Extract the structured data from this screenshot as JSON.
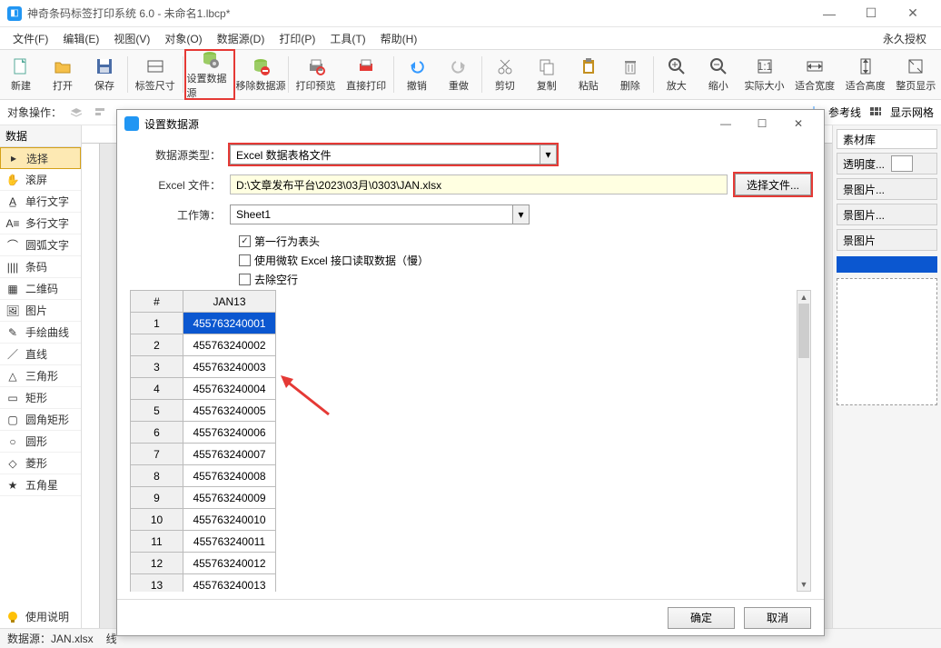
{
  "titlebar": {
    "title": "神奇条码标签打印系统 6.0 - 未命名1.lbcp*"
  },
  "menubar": {
    "items": [
      "文件(F)",
      "编辑(E)",
      "视图(V)",
      "对象(O)",
      "数据源(D)",
      "打印(P)",
      "工具(T)",
      "帮助(H)"
    ],
    "right": "永久授权"
  },
  "toolbar": {
    "items": [
      "新建",
      "打开",
      "保存",
      "标签尺寸",
      "设置数据源",
      "移除数据源",
      "打印预览",
      "直接打印",
      "撤销",
      "重做",
      "剪切",
      "复制",
      "粘贴",
      "删除",
      "放大",
      "缩小",
      "实际大小",
      "适合宽度",
      "适合高度",
      "整页显示"
    ]
  },
  "opsbar": {
    "label": "对象操作：",
    "ref": "参考线",
    "grid": "显示网格"
  },
  "sidebar": {
    "tab": "数据",
    "items": [
      {
        "icon": "cursor",
        "label": "选择",
        "sel": true
      },
      {
        "icon": "hand",
        "label": "滚屏"
      },
      {
        "icon": "A",
        "label": "单行文字"
      },
      {
        "icon": "Am",
        "label": "多行文字"
      },
      {
        "icon": "arc",
        "label": "圆弧文字"
      },
      {
        "icon": "barcode",
        "label": "条码"
      },
      {
        "icon": "qrcode",
        "label": "二维码"
      },
      {
        "icon": "image",
        "label": "图片"
      },
      {
        "icon": "curve",
        "label": "手绘曲线"
      },
      {
        "icon": "line",
        "label": "直线"
      },
      {
        "icon": "tri",
        "label": "三角形"
      },
      {
        "icon": "rect",
        "label": "矩形"
      },
      {
        "icon": "rrect",
        "label": "圆角矩形"
      },
      {
        "icon": "circle",
        "label": "圆形"
      },
      {
        "icon": "diamond",
        "label": "菱形"
      },
      {
        "icon": "star",
        "label": "五角星"
      }
    ]
  },
  "rightpanel": {
    "matlib": "素材库",
    "opacity": "透明度...",
    "bg1": "景图片...",
    "bg2": "景图片...",
    "bg3": "景图片"
  },
  "help": {
    "label": "使用说明"
  },
  "statusbar": {
    "source": "数据源：JAN.xlsx",
    "extra": "线"
  },
  "dialog": {
    "title": "设置数据源",
    "rows": {
      "type_label": "数据源类型：",
      "type_value": "Excel 数据表格文件",
      "file_label": "Excel 文件：",
      "file_value": "D:\\文章发布平台\\2023\\03月\\0303\\JAN.xlsx",
      "choose_btn": "选择文件...",
      "sheet_label": "工作簿：",
      "sheet_value": "Sheet1",
      "chk1": "第一行为表头",
      "chk2": "使用微软 Excel 接口读取数据（慢）",
      "chk3": "去除空行"
    },
    "table": {
      "head": [
        "#",
        "JAN13"
      ],
      "rows": [
        {
          "n": 1,
          "v": "455763240001",
          "sel": true
        },
        {
          "n": 2,
          "v": "455763240002"
        },
        {
          "n": 3,
          "v": "455763240003"
        },
        {
          "n": 4,
          "v": "455763240004"
        },
        {
          "n": 5,
          "v": "455763240005"
        },
        {
          "n": 6,
          "v": "455763240006"
        },
        {
          "n": 7,
          "v": "455763240007"
        },
        {
          "n": 8,
          "v": "455763240008"
        },
        {
          "n": 9,
          "v": "455763240009"
        },
        {
          "n": 10,
          "v": "455763240010"
        },
        {
          "n": 11,
          "v": "455763240011"
        },
        {
          "n": 12,
          "v": "455763240012"
        },
        {
          "n": 13,
          "v": "455763240013"
        }
      ]
    },
    "footer": {
      "ok": "确定",
      "cancel": "取消"
    }
  }
}
